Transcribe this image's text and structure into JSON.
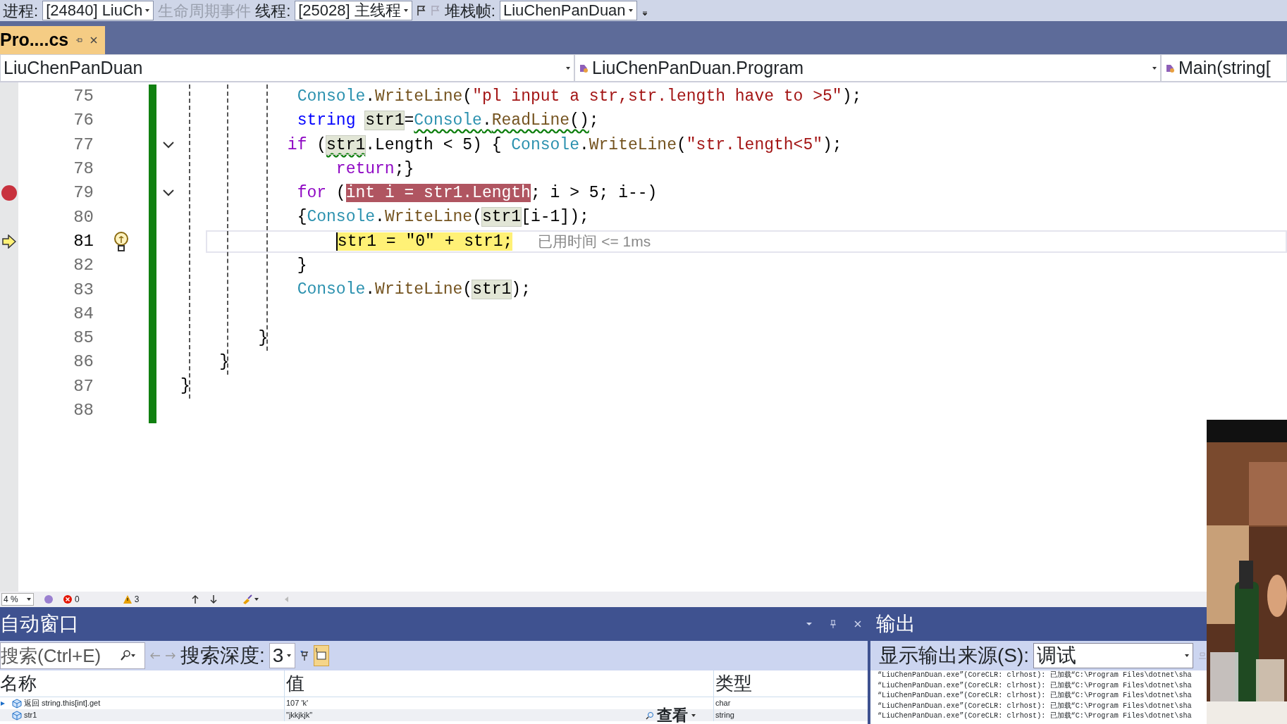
{
  "debug_toolbar": {
    "process_label": "进程:",
    "process": "[24840] LiuCh",
    "lifecycle": "生命周期事件",
    "thread_label": "线程:",
    "thread": "[25028] 主线程",
    "stack_label": "堆栈帧:",
    "stack_frame": "LiuChenPanDuan"
  },
  "tabs": [
    {
      "label": "Pro....cs",
      "selected": true
    }
  ],
  "nav_bar": {
    "project": "LiuChenPanDuan",
    "type": "LiuChenPanDuan.Program",
    "member": "Main(string["
  },
  "editor": {
    "lines": [
      {
        "number": "75",
        "breakpoint": false,
        "current": false,
        "collapsible": false,
        "tokens": [
          {
            "text": "            Console",
            "kind": "class",
            "squiggle": false
          },
          {
            "text": ".",
            "kind": "plain",
            "squiggle": false
          },
          {
            "text": "WriteLine",
            "kind": "method",
            "squiggle": false
          },
          {
            "text": "(",
            "kind": "plain",
            "squiggle": false
          },
          {
            "text": "\"pl input a str,str.length have to >5\"",
            "kind": "string",
            "squiggle": false
          },
          {
            "text": ");",
            "kind": "plain",
            "squiggle": false
          }
        ]
      },
      {
        "number": "76",
        "breakpoint": false,
        "current": false,
        "collapsible": false,
        "tokens": [
          {
            "text": "            string ",
            "kind": "keyword",
            "squiggle": false
          },
          {
            "text": "str1",
            "kind": "ref",
            "squiggle": false
          },
          {
            "text": "=",
            "kind": "plain",
            "squiggle": false
          },
          {
            "text": "Console",
            "kind": "class",
            "squiggle": true
          },
          {
            "text": ".",
            "kind": "plain",
            "squiggle": true
          },
          {
            "text": "ReadLine",
            "kind": "method",
            "squiggle": true
          },
          {
            "text": "()",
            "kind": "plain",
            "squiggle": true
          },
          {
            "text": ";",
            "kind": "plain",
            "squiggle": false
          }
        ]
      },
      {
        "number": "77",
        "breakpoint": false,
        "current": false,
        "collapsible": true,
        "tokens": [
          {
            "text": "           if",
            "kind": "control",
            "squiggle": false
          },
          {
            "text": " (",
            "kind": "plain",
            "squiggle": false
          },
          {
            "text": "str1",
            "kind": "ref",
            "squiggle": true
          },
          {
            "text": ".Length < 5) { ",
            "kind": "plain",
            "squiggle": false
          },
          {
            "text": "Console",
            "kind": "class",
            "squiggle": false
          },
          {
            "text": ".",
            "kind": "plain",
            "squiggle": false
          },
          {
            "text": "WriteLine",
            "kind": "method",
            "squiggle": false
          },
          {
            "text": "(",
            "kind": "plain",
            "squiggle": false
          },
          {
            "text": "\"str.length<5\"",
            "kind": "string",
            "squiggle": false
          },
          {
            "text": ");",
            "kind": "plain",
            "squiggle": false
          }
        ]
      },
      {
        "number": "78",
        "breakpoint": false,
        "current": false,
        "collapsible": false,
        "tokens": [
          {
            "text": "                return",
            "kind": "control",
            "squiggle": false
          },
          {
            "text": ";}",
            "kind": "plain",
            "squiggle": false
          }
        ]
      },
      {
        "number": "79",
        "breakpoint": true,
        "current": false,
        "collapsible": true,
        "tokens": [
          {
            "text": "            for",
            "kind": "control",
            "squiggle": false
          },
          {
            "text": " (",
            "kind": "plain",
            "squiggle": false
          },
          {
            "text": "int i = str1.Length",
            "kind": "bp",
            "squiggle": false
          },
          {
            "text": "; i > 5; i--)",
            "kind": "plain",
            "squiggle": false
          }
        ]
      },
      {
        "number": "80",
        "breakpoint": false,
        "current": false,
        "collapsible": false,
        "tokens": [
          {
            "text": "            {",
            "kind": "plain",
            "squiggle": false
          },
          {
            "text": "Console",
            "kind": "class",
            "squiggle": false
          },
          {
            "text": ".",
            "kind": "plain",
            "squiggle": false
          },
          {
            "text": "WriteLine",
            "kind": "method",
            "squiggle": false
          },
          {
            "text": "(",
            "kind": "plain",
            "squiggle": false
          },
          {
            "text": "str1",
            "kind": "ref",
            "squiggle": false
          },
          {
            "text": "[i-1]);",
            "kind": "plain",
            "squiggle": false
          }
        ]
      },
      {
        "number": "81",
        "breakpoint": false,
        "current": true,
        "collapsible": false,
        "hint": "已用时间 <= 1ms",
        "tokens": [
          {
            "text": "                str1 = \"0\" + str1;",
            "kind": "current",
            "squiggle": false
          }
        ]
      },
      {
        "number": "82",
        "breakpoint": false,
        "current": false,
        "collapsible": false,
        "tokens": [
          {
            "text": "            }",
            "kind": "plain",
            "squiggle": false
          }
        ]
      },
      {
        "number": "83",
        "breakpoint": false,
        "current": false,
        "collapsible": false,
        "tokens": [
          {
            "text": "            Console",
            "kind": "class",
            "squiggle": false
          },
          {
            "text": ".",
            "kind": "plain",
            "squiggle": false
          },
          {
            "text": "WriteLine",
            "kind": "method",
            "squiggle": false
          },
          {
            "text": "(",
            "kind": "plain",
            "squiggle": false
          },
          {
            "text": "str1",
            "kind": "ref",
            "squiggle": false
          },
          {
            "text": ");",
            "kind": "plain",
            "squiggle": false
          }
        ]
      },
      {
        "number": "84",
        "breakpoint": false,
        "current": false,
        "collapsible": false
      },
      {
        "number": "85",
        "breakpoint": false,
        "current": false,
        "collapsible": false,
        "tokens": [
          {
            "text": "        }",
            "kind": "plain",
            "squiggle": false
          }
        ]
      },
      {
        "number": "86",
        "breakpoint": false,
        "current": false,
        "collapsible": false,
        "tokens": [
          {
            "text": "    }",
            "kind": "plain",
            "squiggle": false
          }
        ]
      },
      {
        "number": "87",
        "breakpoint": false,
        "current": false,
        "collapsible": false,
        "tokens": [
          {
            "text": "}",
            "kind": "plain",
            "squiggle": false
          }
        ]
      },
      {
        "number": "88",
        "breakpoint": false,
        "current": false,
        "collapsible": false
      }
    ]
  },
  "status_strip": {
    "zoom": "4 %",
    "errors": "0",
    "warnings": "3"
  },
  "autos": {
    "title": "自动窗口",
    "search_placeholder": "搜索(Ctrl+E)",
    "depth_label": "搜索深度:",
    "depth": "3",
    "columns": [
      "名称",
      "值",
      "类型"
    ],
    "rows": [
      {
        "name": "返回 string.this[int].get",
        "value": "107 'k'",
        "type": "char"
      },
      {
        "name": "str1",
        "value": "\"jkkjkjk\"",
        "type": "string",
        "visualizer": "查看"
      }
    ]
  },
  "output": {
    "title": "输出",
    "source_label": "显示输出来源(S):",
    "source": "调试",
    "lines": [
      "“LiuChenPanDuan.exe”(CoreCLR: clrhost): 已加载“C:\\Program Files\\dotnet\\sha",
      "“LiuChenPanDuan.exe”(CoreCLR: clrhost): 已加载“C:\\Program Files\\dotnet\\sha",
      "“LiuChenPanDuan.exe”(CoreCLR: clrhost): 已加载“C:\\Program Files\\dotnet\\sha",
      "“LiuChenPanDuan.exe”(CoreCLR: clrhost): 已加载“C:\\Program Files\\dotnet\\sha",
      "“LiuChenPanDuan.exe”(CoreCLR: clrhost): 已加载“C:\\Program Files\\dotnet\\sha"
    ]
  }
}
